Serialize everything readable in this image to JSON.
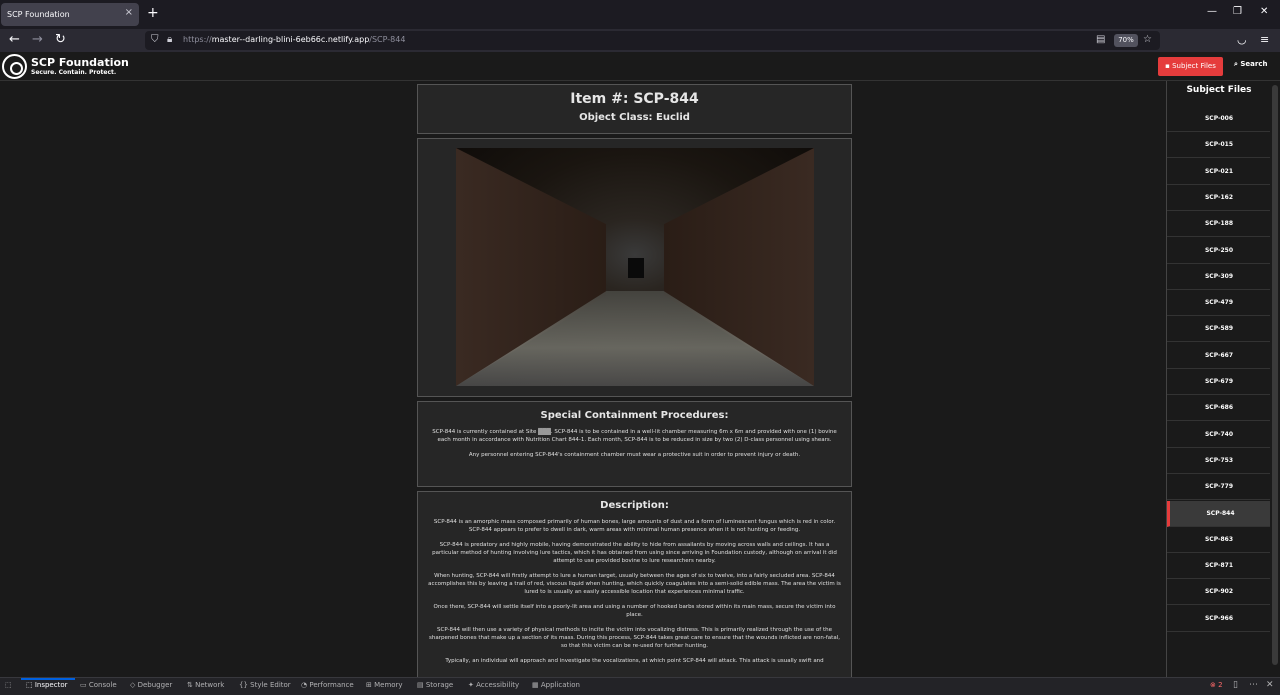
{
  "browser": {
    "tab_title": "SCP Foundation",
    "tab_close": "×",
    "new_tab": "+",
    "url_scheme": "https://",
    "url_host": "master--darling-blini-6eb66c.netlify.app",
    "url_path": "/SCP-844",
    "zoom": "70%"
  },
  "site": {
    "title": "SCP Foundation",
    "tagline": "Secure. Contain. Protect.",
    "subject_files_button": "Subject Files",
    "search_button": "Search"
  },
  "entry": {
    "item_number": "Item #: SCP-844",
    "object_class": "Object Class: Euclid",
    "containment_heading": "Special Containment Procedures:",
    "containment_p1_a": "SCP-844 is currently contained at Site ",
    "containment_p1_redacted": "███",
    "containment_p1_b": ". SCP-844 is to be contained in a well-lit chamber measuring 6m x 6m and provided with one (1) bovine each month in accordance with Nutrition Chart 844-1. Each month, SCP-844 is to be reduced in size by two (2) D-class personnel using shears.",
    "containment_p2": "Any personnel entering SCP-844's containment chamber must wear a protective suit in order to prevent injury or death.",
    "description_heading": "Description:",
    "description_paragraphs": [
      "SCP-844 is an amorphic mass composed primarily of human bones, large amounts of dust and a form of luminescent fungus which is red in color. SCP-844 appears to prefer to dwell in dark, warm areas with minimal human presence when it is not hunting or feeding.",
      "SCP-844 is predatory and highly mobile, having demonstrated the ability to hide from assailants by moving across walls and ceilings. It has a particular method of hunting involving lure tactics, which it has obtained from using since arriving in Foundation custody, although on arrival it did attempt to use provided bovine to lure researchers nearby.",
      "When hunting, SCP-844 will firstly attempt to lure a human target, usually between the ages of six to twelve, into a fairly secluded area. SCP-844 accomplishes this by leaving a trail of red, viscous liquid when hunting, which quickly coagulates into a semi-solid edible mass. The area the victim is lured to is usually an easily accessible location that experiences minimal traffic.",
      "Once there, SCP-844 will settle itself into a poorly-lit area and using a number of hooked barbs stored within its main mass, secure the victim into place.",
      "SCP-844 will then use a variety of physical methods to incite the victim into vocalizing distress. This is primarily realized through the use of the sharpened bones that make up a section of its mass. During this process, SCP-844 takes great care to ensure that the wounds inflicted are non-fatal, so that this victim can be re-used for further hunting.",
      "Typically, an individual will approach and investigate the vocalizations, at which point SCP-844 will attack. This attack is usually swift and"
    ]
  },
  "sidebar": {
    "title": "Subject Files",
    "items": [
      "SCP-006",
      "SCP-015",
      "SCP-021",
      "SCP-162",
      "SCP-188",
      "SCP-250",
      "SCP-309",
      "SCP-479",
      "SCP-589",
      "SCP-667",
      "SCP-679",
      "SCP-686",
      "SCP-740",
      "SCP-753",
      "SCP-779",
      "SCP-844",
      "SCP-863",
      "SCP-871",
      "SCP-902",
      "SCP-966"
    ],
    "active": "SCP-844"
  },
  "devtools": {
    "tabs": [
      "Inspector",
      "Console",
      "Debugger",
      "Network",
      "Style Editor",
      "Performance",
      "Memory",
      "Storage",
      "Accessibility",
      "Application"
    ],
    "active_tab": "Inspector",
    "error_count": "2"
  },
  "colors": {
    "accent": "#e53c3c",
    "devtools_active": "#0060df"
  }
}
